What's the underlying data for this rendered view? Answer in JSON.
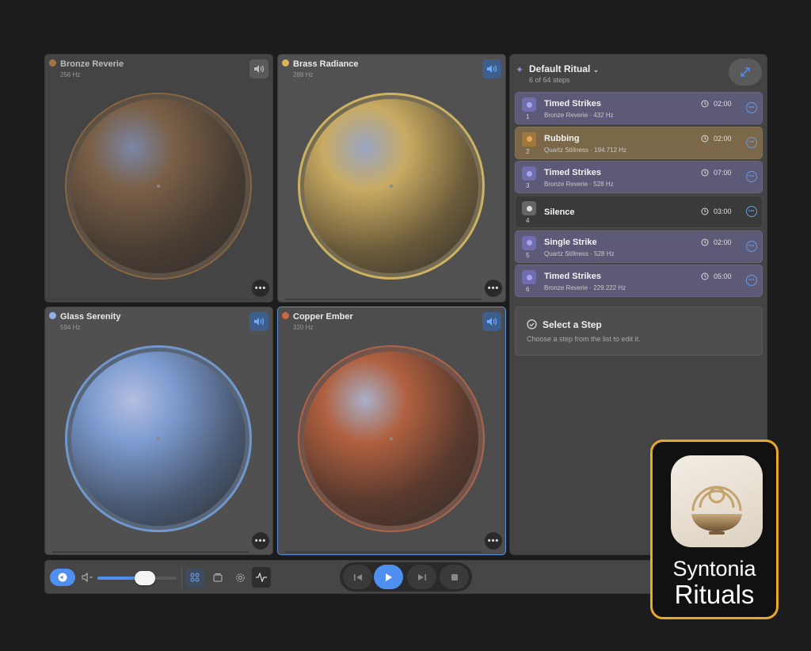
{
  "colors": {
    "accent": "#4f8ff0",
    "bronze": "#a8743e",
    "brass": "#d9b45a",
    "glass": "#8fb1e8",
    "copper": "#c8674a",
    "badge_border": "#e8a92a"
  },
  "bowls": [
    {
      "name": "Bronze Reverie",
      "freq": "256 Hz",
      "speaker": "speaker-icon",
      "active": false
    },
    {
      "name": "Brass Radiance",
      "freq": "288 Hz",
      "speaker": "speaker-icon",
      "active": true
    },
    {
      "name": "Glass Serenity",
      "freq": "594 Hz",
      "speaker": "speaker-icon",
      "active": true
    },
    {
      "name": "Copper Ember",
      "freq": "320 Hz",
      "speaker": "speaker-icon",
      "active": true
    }
  ],
  "ritual": {
    "title": "Default Ritual",
    "subtitle": "6 of 64 steps",
    "steps": [
      {
        "num": "1",
        "title": "Timed Strikes",
        "sub": "Bronze Reverie · 432 Hz",
        "dur": "02:00",
        "style": "purple"
      },
      {
        "num": "2",
        "title": "Rubbing",
        "sub": "Quartz Stillness · 194.712 Hz",
        "dur": "02:00",
        "style": "gold"
      },
      {
        "num": "3",
        "title": "Timed Strikes",
        "sub": "Bronze Reverie · 528 Hz",
        "dur": "07:00",
        "style": "purple"
      },
      {
        "num": "4",
        "title": "Silence",
        "sub": "",
        "dur": "03:00",
        "style": "dark"
      },
      {
        "num": "5",
        "title": "Single Strike",
        "sub": "Quartz Stillness · 528 Hz",
        "dur": "02:00",
        "style": "purple"
      },
      {
        "num": "6",
        "title": "Timed Strikes",
        "sub": "Bronze Reverie · 229.222 Hz",
        "dur": "05:00",
        "style": "purple"
      }
    ],
    "select_title": "Select a Step",
    "select_sub": "Choose a step from the list to edit it."
  },
  "toolbar": {
    "volume_level": 0.6
  },
  "badge": {
    "line1": "Syntonia",
    "line2": "Rituals"
  }
}
